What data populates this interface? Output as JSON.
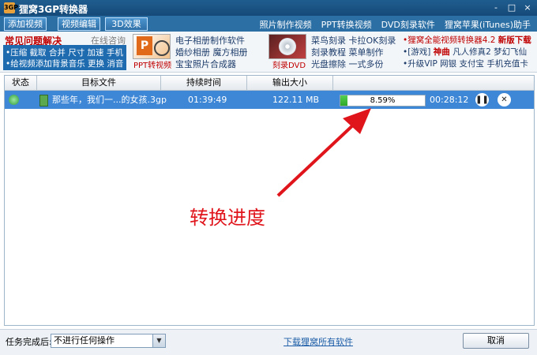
{
  "window": {
    "title": "狸窝3GP转换器",
    "logo_text": "3GP",
    "controls": [
      "-",
      "□",
      "×"
    ]
  },
  "toolbar": {
    "buttons": [
      "添加视频",
      "视频编辑",
      "3D效果"
    ],
    "links": [
      "照片制作视频",
      "PPT转换视频",
      "DVD刻录软件",
      "狸窝苹果(iTunes)助手"
    ]
  },
  "banner": {
    "faq_title": "常见问题解决",
    "faq_online": "在线咨询",
    "faq_line1": "•压缩 截取 合并 尺寸 加速 手机",
    "faq_line2": "•给视频添加背景音乐 更换 消音",
    "promo1": {
      "icon_label": "PPT转视频",
      "lines": [
        "电子相册制作软件",
        "婚纱相册  魔方相册",
        "宝宝照片合成器"
      ]
    },
    "promo2": {
      "icon_label": "刻录DVD",
      "lines": [
        "菜鸟刻录  卡拉OK刻录",
        "刻录教程  菜单制作",
        "光盘擦除  一式多份"
      ]
    },
    "promo3": {
      "line1_a": "•狸窝全能视频转换器4.2",
      "line1_b": "新版下载",
      "line2_a": "•[游戏]",
      "line2_b": "神曲",
      "line2_c": "凡人修真2  梦幻飞仙",
      "line3": "•升级VIP  网银  支付宝  手机充值卡"
    }
  },
  "table": {
    "headers": [
      "状态",
      "目标文件",
      "持续时间",
      "输出大小",
      ""
    ],
    "rows": [
      {
        "file": "那些年，我们一...的女孩.3gp",
        "duration": "01:39:49",
        "size": "122.11 MB",
        "progress_text": "8.59%",
        "progress": 0.0859,
        "remaining": "00:28:12"
      }
    ]
  },
  "annotation": {
    "text": "转换进度",
    "color": "#e0141b"
  },
  "footer": {
    "after_label": "任务完成后:",
    "after_value": "不进行任何操作",
    "download_link": "下载狸窝所有软件",
    "cancel_label": "取消"
  }
}
